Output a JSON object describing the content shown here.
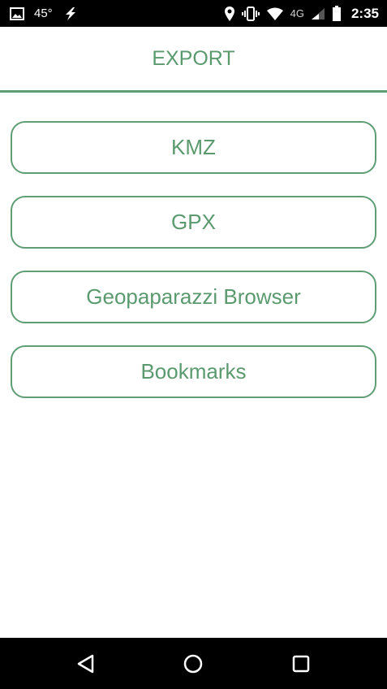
{
  "status_bar": {
    "temperature": "45°",
    "network": "4G",
    "time": "2:35",
    "icons": [
      "image-icon",
      "flash-icon",
      "location-icon",
      "vibrate-icon",
      "wifi-icon",
      "signal-icon",
      "battery-icon"
    ]
  },
  "header": {
    "title": "EXPORT"
  },
  "export_options": [
    {
      "label": "KMZ"
    },
    {
      "label": "GPX"
    },
    {
      "label": "Geopaparazzi Browser"
    },
    {
      "label": "Bookmarks"
    }
  ],
  "nav_bar": {
    "icons": [
      "back-icon",
      "home-icon",
      "recents-icon"
    ]
  },
  "colors": {
    "accent": "#5f9e74",
    "text_accent": "#5a9a6e",
    "bars": "#000000"
  }
}
